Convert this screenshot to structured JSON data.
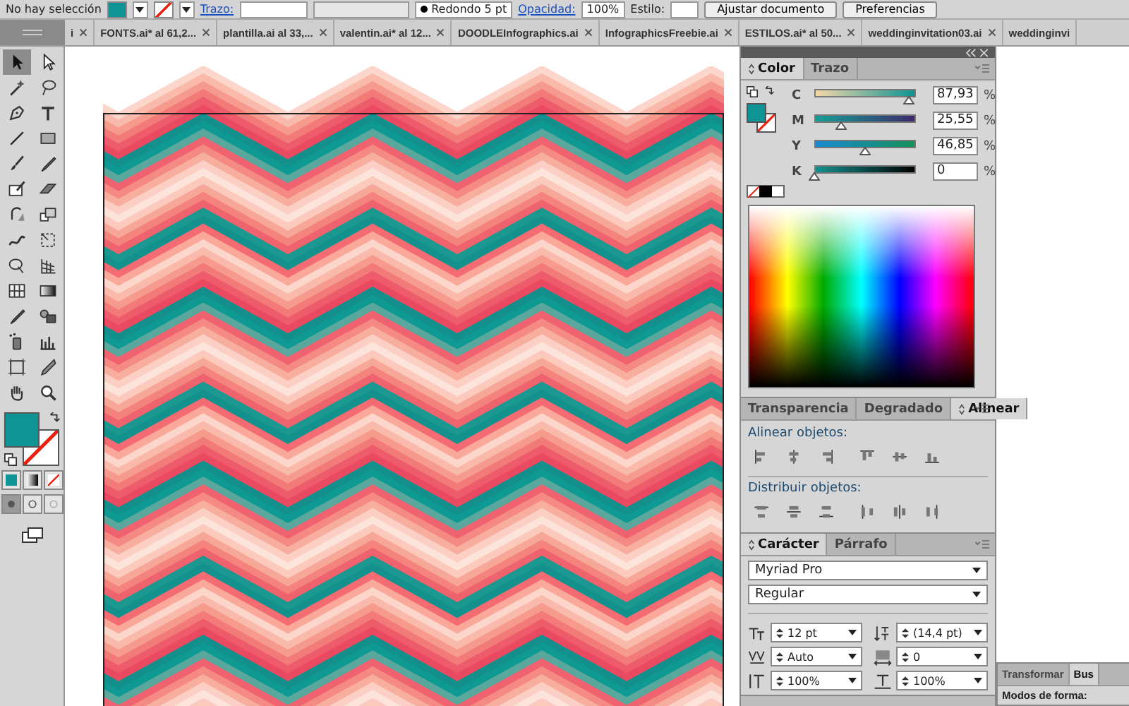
{
  "control_bar": {
    "selection": "No hay selección",
    "stroke_link": "Trazo:",
    "brush": "Redondo 5 pt",
    "opacity_link": "Opacidad:",
    "opacity": "100%",
    "style_label": "Estilo:",
    "buttons": [
      "Ajustar documento",
      "Preferencias"
    ]
  },
  "document_tabs": [
    {
      "label": "i"
    },
    {
      "label": "FONTS.ai* al 61,2..."
    },
    {
      "label": "plantilla.ai al 33,..."
    },
    {
      "label": "valentin.ai* al 12..."
    },
    {
      "label": "DOODLEInfographics.ai"
    },
    {
      "label": "InfographicsFreebie.ai"
    },
    {
      "label": "ESTILOS.ai* al 50..."
    },
    {
      "label": "weddinginvitation03.ai"
    },
    {
      "label": "weddinginvi"
    }
  ],
  "tools": [
    {
      "kind": "selection",
      "selected": true
    },
    {
      "kind": "direct-selection",
      "selected": false
    },
    {
      "kind": "magic-wand",
      "selected": false
    },
    {
      "kind": "lasso",
      "selected": false
    },
    {
      "kind": "pen",
      "selected": false
    },
    {
      "kind": "type",
      "selected": false
    },
    {
      "kind": "line",
      "selected": false
    },
    {
      "kind": "rectangle",
      "selected": false
    },
    {
      "kind": "brush",
      "selected": false
    },
    {
      "kind": "pencil",
      "selected": false
    },
    {
      "kind": "blob-brush",
      "selected": false
    },
    {
      "kind": "eraser",
      "selected": false
    },
    {
      "kind": "rotate",
      "selected": false
    },
    {
      "kind": "scale",
      "selected": false
    },
    {
      "kind": "warp",
      "selected": false
    },
    {
      "kind": "free-transform",
      "selected": false
    },
    {
      "kind": "shape-builder",
      "selected": false
    },
    {
      "kind": "perspective",
      "selected": false
    },
    {
      "kind": "mesh",
      "selected": false
    },
    {
      "kind": "gradient",
      "selected": false
    },
    {
      "kind": "eyedropper",
      "selected": false
    },
    {
      "kind": "blend",
      "selected": false
    },
    {
      "kind": "symbol",
      "selected": false
    },
    {
      "kind": "graph",
      "selected": false
    },
    {
      "kind": "artboard",
      "selected": false
    },
    {
      "kind": "slice",
      "selected": false
    },
    {
      "kind": "hand",
      "selected": false
    },
    {
      "kind": "zoom",
      "selected": false
    }
  ],
  "color_panel": {
    "tabs": [
      {
        "label": "Color",
        "selected": true
      },
      {
        "label": "Trazo",
        "selected": false
      }
    ],
    "channels": [
      {
        "label": "C",
        "level": 0.8793,
        "value": "87,93",
        "unit": "%"
      },
      {
        "label": "M",
        "level": 0.2555,
        "value": "25,55",
        "unit": "%"
      },
      {
        "label": "Y",
        "level": 0.4685,
        "value": "46,85",
        "unit": "%"
      },
      {
        "label": "K",
        "level": 0,
        "value": "0",
        "unit": "%"
      }
    ]
  },
  "align_panel": {
    "tabs": [
      {
        "label": "Transparencia",
        "selected": false
      },
      {
        "label": "Degradado",
        "selected": false
      },
      {
        "label": "Alinear",
        "selected": true
      }
    ],
    "align_label": "Alinear objetos:",
    "distribute_label": "Distribuir objetos:"
  },
  "character_panel": {
    "tabs": [
      {
        "label": "Carácter",
        "selected": true
      },
      {
        "label": "Párrafo",
        "selected": false
      }
    ],
    "font": "Myriad Pro",
    "style": "Regular",
    "fields": [
      {
        "kind": "size",
        "value": "12 pt"
      },
      {
        "kind": "leading",
        "value": "(14,4 pt)"
      },
      {
        "kind": "kerning",
        "value": "Auto"
      },
      {
        "kind": "tracking",
        "value": "0"
      },
      {
        "kind": "vertical-scale",
        "value": "100%"
      },
      {
        "kind": "horizontal-scale",
        "value": "100%"
      }
    ]
  },
  "bottom_panel": {
    "tabs": [
      {
        "label": "Transformar",
        "selected": false
      },
      {
        "label": "Bus",
        "selected": true
      }
    ],
    "label": "Modos de forma:"
  }
}
